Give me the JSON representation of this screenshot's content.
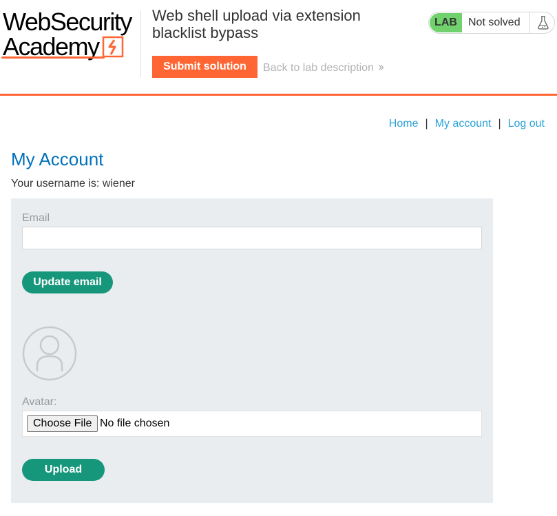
{
  "header": {
    "logo": {
      "line1": "WebSecurity",
      "line2": "Academy"
    },
    "lab_title": "Web shell upload via extension blacklist bypass",
    "submit_label": "Submit solution",
    "back_label": "Back to lab description",
    "back_icon": "double-chevron-right-icon",
    "lab_badge": "LAB",
    "lab_status": "Not solved",
    "lab_icon": "flask-icon",
    "accent_color": "#ff6633",
    "badge_color": "#70d16d"
  },
  "nav": {
    "home": "Home",
    "my_account": "My account",
    "log_out": "Log out",
    "separator": "|",
    "link_color": "#29a3d7"
  },
  "page": {
    "title": "My Account",
    "username_text": "Your username is: wiener"
  },
  "form": {
    "email_label": "Email",
    "email_value": "",
    "update_label": "Update email",
    "avatar_icon": "user-avatar-icon",
    "avatar_label": "Avatar:",
    "choose_file_label": "Choose File",
    "file_status": "No file chosen",
    "upload_label": "Upload",
    "button_color": "#16977b",
    "panel_color": "#e9edf0"
  }
}
